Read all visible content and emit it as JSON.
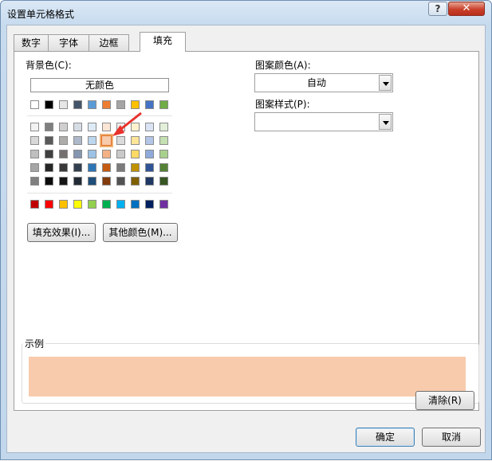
{
  "window": {
    "title": "设置单元格格式",
    "help_label": "?",
    "close_label": "✕"
  },
  "tabs": [
    {
      "label": "数字",
      "active": false
    },
    {
      "label": "字体",
      "active": false
    },
    {
      "label": "边框",
      "active": false
    },
    {
      "label": "填充",
      "active": true
    }
  ],
  "fill": {
    "background_label": "背景色(C):",
    "no_color_label": "无颜色",
    "theme_row": [
      "#ffffff",
      "#000000",
      "#e7e6e6",
      "#44546a",
      "#5b9bd5",
      "#ed7d31",
      "#a5a5a5",
      "#ffc000",
      "#4472c4",
      "#70ad47"
    ],
    "tint_rows": [
      [
        "#f2f2f2",
        "#7f7f7f",
        "#d0cece",
        "#d6dce4",
        "#deebf6",
        "#fbe5d5",
        "#ededed",
        "#fff2cc",
        "#dae3f3",
        "#e2efd9"
      ],
      [
        "#d8d8d8",
        "#595959",
        "#aeabab",
        "#adb9ca",
        "#bdd7ee",
        "#f7cbac",
        "#dbdbdb",
        "#fee599",
        "#b4c6e7",
        "#c5e0b3"
      ],
      [
        "#bfbfbf",
        "#3f3f3f",
        "#757070",
        "#8496b0",
        "#9cc3e5",
        "#f4b183",
        "#c9c9c9",
        "#ffd966",
        "#8eaadb",
        "#a8d08d"
      ],
      [
        "#a5a5a5",
        "#262626",
        "#3a3838",
        "#323f4f",
        "#2e75b5",
        "#c55a11",
        "#7b7b7b",
        "#bf9000",
        "#2f5496",
        "#538135"
      ],
      [
        "#7f7f7f",
        "#0c0c0c",
        "#171616",
        "#222a35",
        "#1e4e79",
        "#833c0b",
        "#525252",
        "#7f6000",
        "#1f3864",
        "#375623"
      ]
    ],
    "standard_row": [
      "#c00000",
      "#ff0000",
      "#ffc000",
      "#ffff00",
      "#92d050",
      "#00b050",
      "#00b0f0",
      "#0070c0",
      "#002060",
      "#7030a0"
    ],
    "selected_color": "#f7cbac",
    "fill_effects_label": "填充效果(I)...",
    "more_colors_label": "其他颜色(M)...",
    "pattern_color_label": "图案颜色(A):",
    "pattern_color_value": "自动",
    "pattern_style_label": "图案样式(P):",
    "pattern_style_value": "",
    "sample_label": "示例",
    "sample_color": "#f7cbac",
    "clear_label": "清除(R)"
  },
  "footer": {
    "ok_label": "确定",
    "cancel_label": "取消"
  }
}
